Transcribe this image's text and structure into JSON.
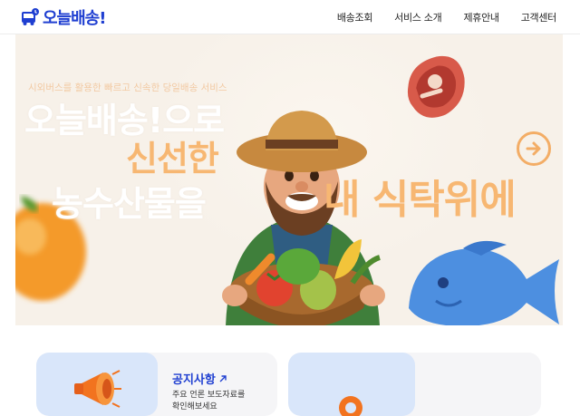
{
  "header": {
    "logo_text": "오늘배송!",
    "nav": [
      "배송조회",
      "서비스 소개",
      "제휴안내",
      "고객센터"
    ]
  },
  "hero": {
    "tagline": "시외버스를 활용한 빠르고 신속한 당일배송 서비스",
    "line1": "오늘배송!으로",
    "line2": "신선한",
    "line3": "농수산물을",
    "line4": "내 식탁위에"
  },
  "cards": [
    {
      "title": "공지사항",
      "desc_line1": "주요 언론 보도자료를",
      "desc_line2": "확인해보세요"
    }
  ],
  "colors": {
    "brand": "#1f3fd1",
    "accent": "#f7b772",
    "hero_bg": "#f7f1e9"
  }
}
